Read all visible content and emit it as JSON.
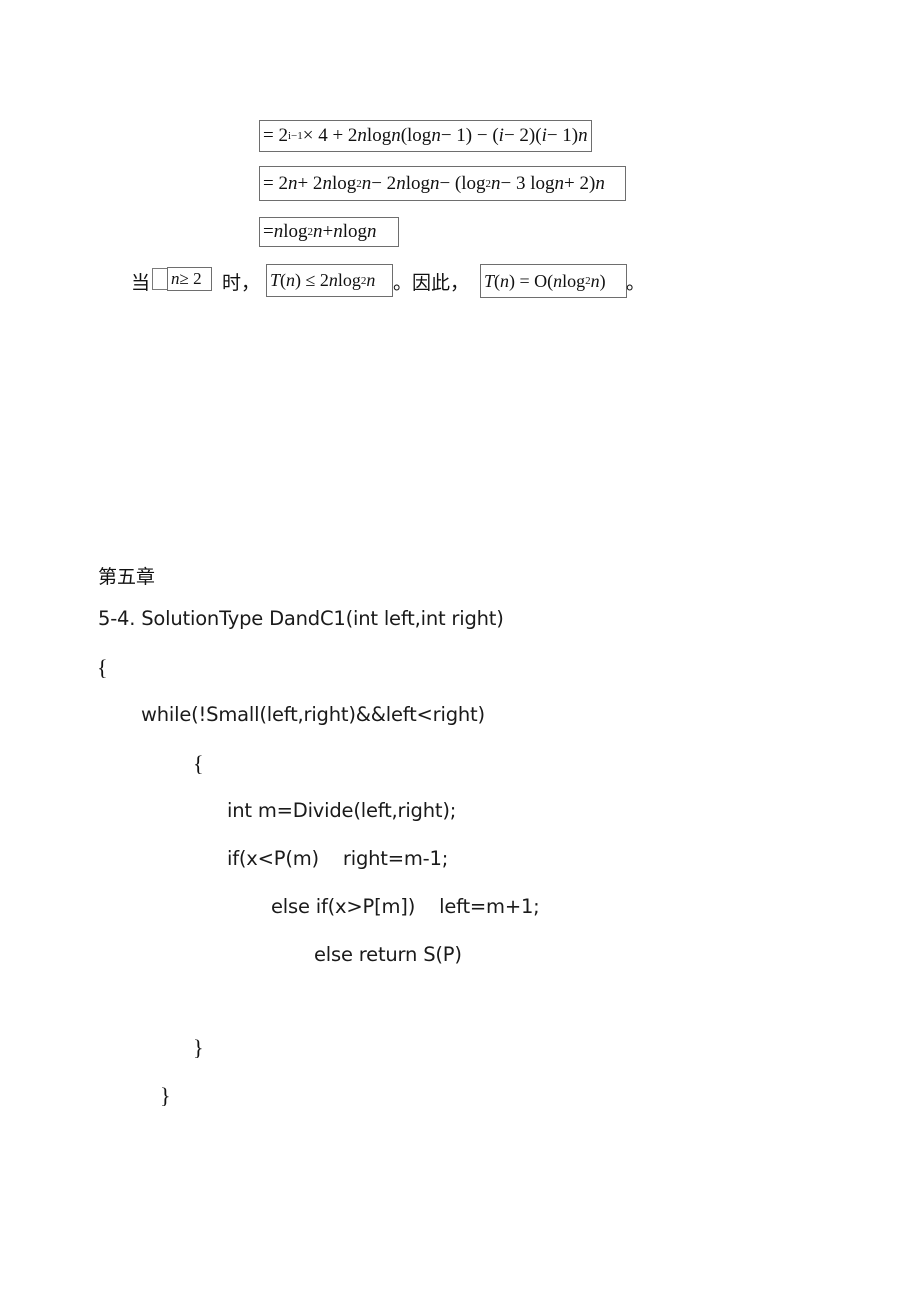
{
  "derivation": {
    "line1": {
      "parts": [
        "= 2",
        "i−1",
        " × 4 + 2",
        "n",
        " log ",
        "n",
        "(log ",
        "n",
        " − 1) − (",
        "i",
        " − 2)(",
        "i",
        " − 1)",
        "n"
      ]
    },
    "line2": {
      "parts": [
        "= 2",
        "n",
        " + 2",
        "n",
        " log",
        "2",
        " ",
        "n",
        " − 2",
        "n",
        " log ",
        "n",
        " − (log",
        "2",
        " ",
        "n",
        " − 3 log ",
        "n",
        " + 2)",
        "n"
      ]
    },
    "line3": {
      "parts": [
        "= ",
        "n",
        " log",
        "2",
        " ",
        "n",
        " + ",
        "n",
        " log ",
        "n"
      ]
    }
  },
  "conclusion": {
    "prefix": "当",
    "condition_parts": [
      "n",
      " ≥ 2"
    ],
    "mid": "时，",
    "bound_parts": [
      "T",
      "(",
      "n",
      ") ≤ 2",
      "n",
      " log",
      "2",
      " ",
      "n"
    ],
    "therefore": "。因此，",
    "result_parts": [
      "T",
      "(",
      "n",
      ") = O(",
      "n",
      " log",
      "2",
      " ",
      "n",
      ")"
    ],
    "end": "。"
  },
  "chapter": {
    "title": "第五章"
  },
  "code": {
    "lines": [
      "5-4. SolutionType DandC1(int left,int right)",
      "{",
      "while(!Small(left,right)&&left<right)",
      "{",
      "int m=Divide(left,right);",
      "if(x<P(m)    right=m-1;",
      "else if(x>P[m])    left=m+1;",
      "else return S(P)",
      "}",
      "}"
    ]
  }
}
